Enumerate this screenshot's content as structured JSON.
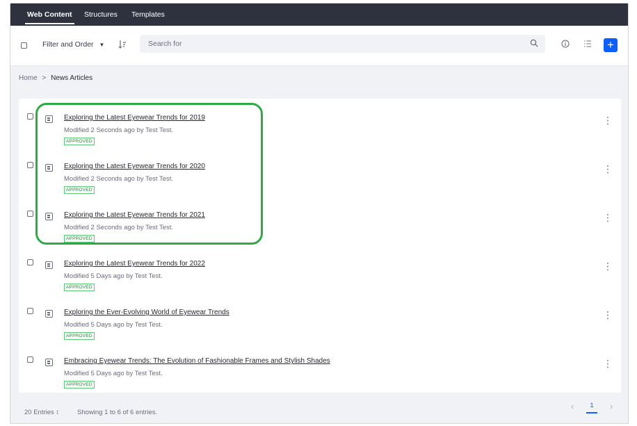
{
  "top_tabs": [
    {
      "label": "Web Content",
      "active": true
    },
    {
      "label": "Structures",
      "active": false
    },
    {
      "label": "Templates",
      "active": false
    }
  ],
  "toolbar": {
    "filter_label": "Filter and Order",
    "search_placeholder": "Search for",
    "add_label": "+"
  },
  "breadcrumb": {
    "home": "Home",
    "separator": ">",
    "current": "News Articles"
  },
  "articles": [
    {
      "title": "Exploring the Latest Eyewear Trends for 2019",
      "meta": "Modified 2 Seconds ago by Test Test.",
      "status": "APPROVED"
    },
    {
      "title": "Exploring the Latest Eyewear Trends for 2020",
      "meta": "Modified 2 Seconds ago by Test Test.",
      "status": "APPROVED"
    },
    {
      "title": "Exploring the Latest Eyewear Trends for 2021",
      "meta": "Modified 2 Seconds ago by Test Test.",
      "status": "APPROVED"
    },
    {
      "title": "Exploring the Latest Eyewear Trends for 2022",
      "meta": "Modified 5 Days ago by Test Test.",
      "status": "APPROVED"
    },
    {
      "title": "Exploring the Ever-Evolving World of Eyewear Trends",
      "meta": "Modified 5 Days ago by Test Test.",
      "status": "APPROVED"
    },
    {
      "title": "Embracing Eyewear Trends: The Evolution of Fashionable Frames and Stylish Shades",
      "meta": "Modified 5 Days ago by Test Test.",
      "status": "APPROVED"
    }
  ],
  "footer": {
    "entries_select": "20 Entries ↕",
    "showing": "Showing 1 to 6 of 6 entries.",
    "current_page": "1"
  },
  "icons": {
    "search": "search-icon",
    "info": "info-icon",
    "list_view": "list-view-icon",
    "sort": "sort-icon",
    "article": "web-content-article-icon",
    "kebab": "vertical-ellipsis-icon"
  },
  "colors": {
    "nav_bg": "#30313f",
    "primary": "#0b5fff",
    "approved": "#287d3c",
    "highlight": "#2eaa45"
  }
}
